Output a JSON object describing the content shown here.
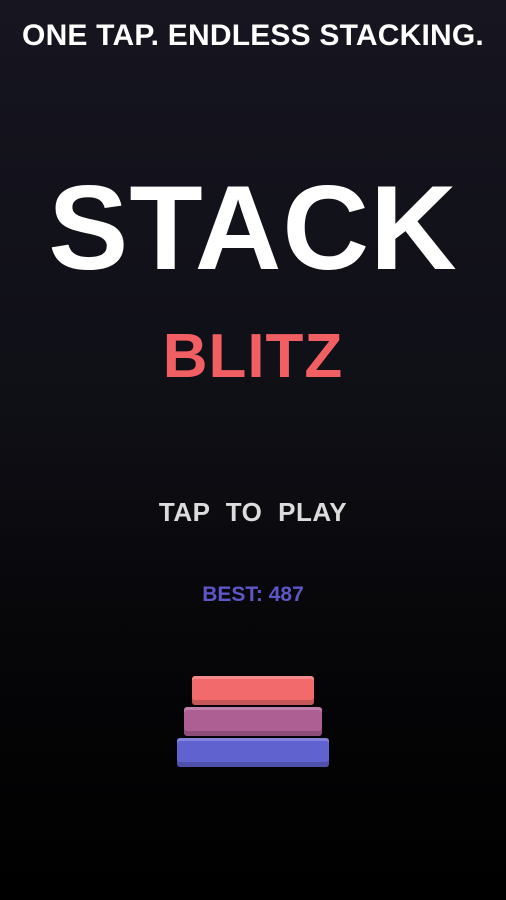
{
  "tagline": "ONE TAP. ENDLESS STACKING.",
  "title": {
    "main": "STACK",
    "sub": "BLITZ"
  },
  "prompt": "TAP  TO  PLAY",
  "best": {
    "label": "BEST: 487"
  },
  "colors": {
    "accent": "#f25f62",
    "best": "#5c57c4",
    "block_top": "#f36a6c",
    "block_mid": "#ad5e93",
    "block_bottom": "#6062cf"
  }
}
